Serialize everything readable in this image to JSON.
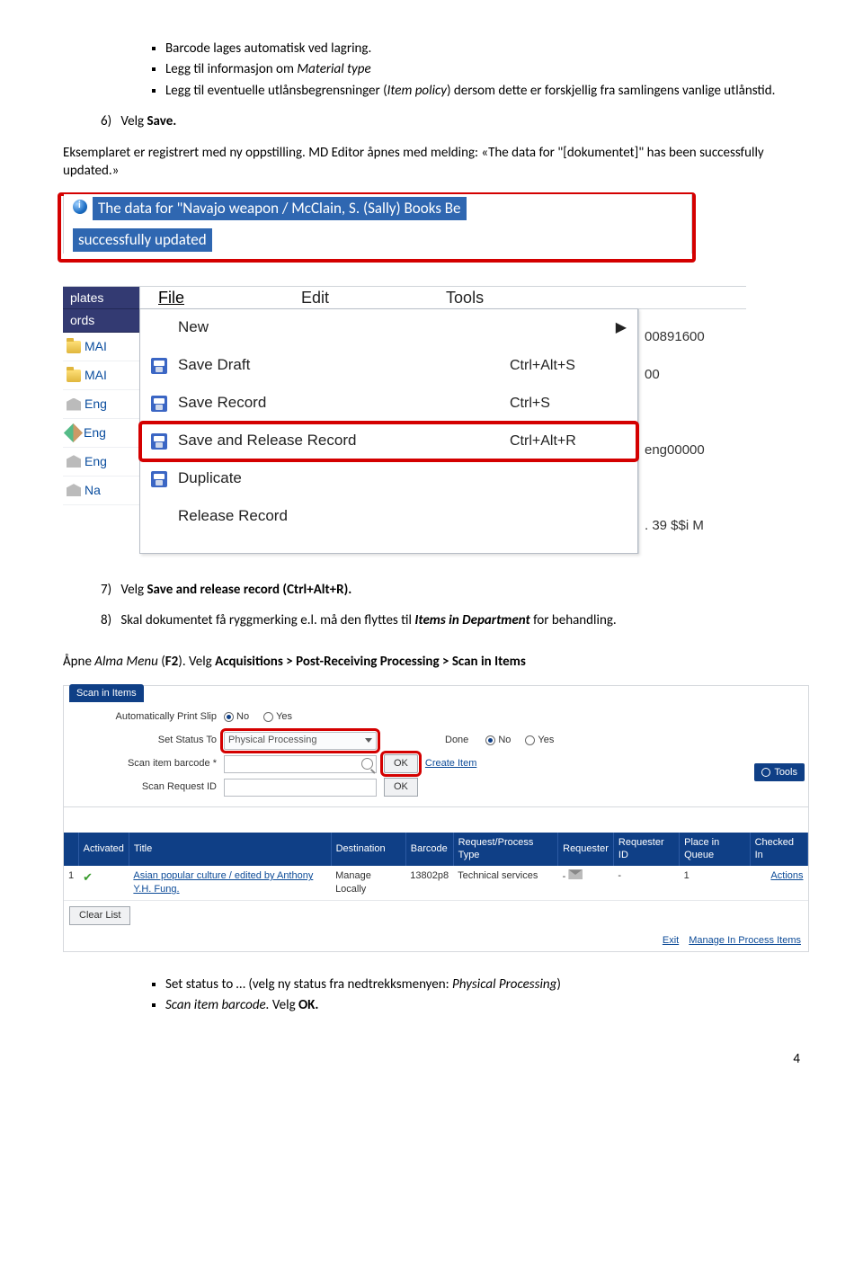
{
  "bullets_top": {
    "b1": "Barcode lages automatisk ved lagring.",
    "b2_a": "Legg til informasjon om ",
    "b2_b": "Material type",
    "b3_a": "Legg til eventuelle utlånsbegrensninger (",
    "b3_b": "Item policy",
    "b3_c": ") dersom dette er forskjellig fra samlingens vanlige utlånstid."
  },
  "step6": {
    "num": "6)",
    "text_a": "Velg ",
    "text_b": "Save."
  },
  "para1_a": "Eksemplaret er registrert med ny oppstilling. MD Editor åpnes med melding: «The data for \"[dokumentet]\" has been successfully updated.»",
  "info_banner": {
    "line1": "The data for \"Navajo weapon / McClain, S. (Sally) Books Be",
    "line2": "successfully updated"
  },
  "md_editor": {
    "left_tabs": {
      "plates": "plates",
      "ords": "ords"
    },
    "left_items": [
      "MAI",
      "MAI",
      "Eng",
      "Eng",
      "Eng",
      "Na"
    ],
    "menu": {
      "file": "File",
      "edit": "Edit",
      "tools": "Tools"
    },
    "dropdown": [
      {
        "label": "New",
        "shortcut": "",
        "arrow": true,
        "icon": "blank"
      },
      {
        "label": "Save Draft",
        "shortcut": "Ctrl+Alt+S",
        "icon": "save"
      },
      {
        "label": "Save Record",
        "shortcut": "Ctrl+S",
        "icon": "save"
      },
      {
        "label": "Save and Release Record",
        "shortcut": "Ctrl+Alt+R",
        "icon": "save",
        "highlight": true
      },
      {
        "label": "Duplicate",
        "shortcut": "",
        "icon": "save"
      },
      {
        "label": "Release Record",
        "shortcut": "",
        "icon": "blank"
      }
    ],
    "hints": [
      "",
      "00891600",
      "00",
      "",
      "eng00000",
      "",
      ". 39 $$i M",
      ""
    ]
  },
  "step7": {
    "num": "7)",
    "a": "Velg ",
    "b": "Save and release record (Ctrl+Alt+R)."
  },
  "step8": {
    "num": "8)",
    "a": "Skal dokumentet få ryggmerking e.l. må den flyttes til ",
    "b": "Items in Department",
    "c": " for behandling."
  },
  "openmenu": {
    "a": "Åpne ",
    "b": "Alma Menu",
    "c": " (",
    "d": "F2",
    "e": "). Velg ",
    "f": "Acquisitions > Post-Receiving Processing > Scan in Items"
  },
  "scan": {
    "tab": "Scan in Items",
    "rows": {
      "r1_lbl": "Automatically Print Slip",
      "r2_lbl": "Set Status To",
      "r2_val": "Physical Processing",
      "r2_done": "Done",
      "r3_lbl": "Scan item barcode *",
      "r3_btn": "OK",
      "r3_link": "Create Item",
      "r4_lbl": "Scan Request ID",
      "r4_btn": "OK"
    },
    "radio": {
      "no": "No",
      "yes": "Yes"
    },
    "tools": "Tools",
    "headers": [
      "",
      "Activated",
      "Title",
      "Destination",
      "Barcode",
      "Request/Process Type",
      "Requester",
      "Requester ID",
      "Place in Queue",
      "Checked In"
    ],
    "row1": {
      "num": "1",
      "title": "Asian popular culture / edited by Anthony Y.H. Fung.",
      "dest": "Manage Locally",
      "barcode": "13802p8",
      "rpt": "Technical services",
      "requester": "-",
      "rid": "-",
      "piq": "1",
      "checked": ""
    },
    "actions": "Actions",
    "clear": "Clear List",
    "exit": "Exit",
    "manage": "Manage In Process Items"
  },
  "bullets_bottom": {
    "b1_a": "Set status to … (velg ny status fra nedtrekksmenyen: ",
    "b1_b": "Physical Processing",
    "b1_c": ")",
    "b2_a": "Scan item barcode.",
    "b2_b": " Velg ",
    "b2_c": "OK."
  },
  "page_number": "4"
}
